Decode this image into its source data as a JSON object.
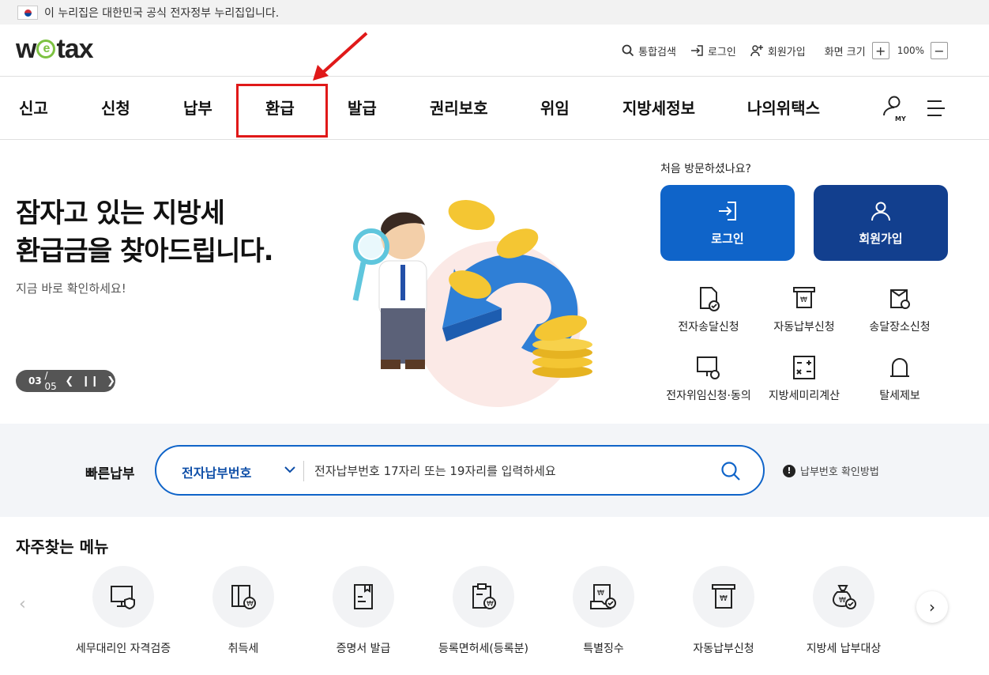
{
  "gov_banner": {
    "text": "이 누리집은 대한민국 공식 전자정부 누리집입니다."
  },
  "header": {
    "logo": {
      "pre": "w",
      "e": "e",
      "post": "tax"
    },
    "search": "통합검색",
    "login": "로그인",
    "signup": "회원가입",
    "zoom_label": "화면 크기",
    "zoom_plus": "+",
    "zoom_value": "100%",
    "zoom_minus": "−"
  },
  "nav": {
    "items": [
      "신고",
      "신청",
      "납부",
      "환급",
      "발급",
      "권리보호",
      "위임",
      "지방세정보",
      "나의위택스"
    ],
    "my_label": "MY"
  },
  "hero": {
    "title_line1": "잠자고 있는 지방세",
    "title_line2": "환급금을 찾아드립니다.",
    "subtitle": "지금 바로 확인하세요!",
    "pager_current": "03",
    "pager_total": "/ 05"
  },
  "side": {
    "first_visit": "처음 방문하셨나요?",
    "login_button": "로그인",
    "join_button": "회원가입",
    "quick_links": [
      "전자송달신청",
      "자동납부신청",
      "송달장소신청",
      "전자위임신청·동의",
      "지방세미리계산",
      "탈세제보"
    ]
  },
  "fastpay": {
    "label": "빠른납부",
    "select_value": "전자납부번호",
    "placeholder": "전자납부번호 17자리 또는 19자리를 입력하세요",
    "help": "납부번호 확인방법"
  },
  "frequent": {
    "title": "자주찾는 메뉴",
    "items": [
      "세무대리인 자격검증",
      "취득세",
      "증명서 발급",
      "등록면허세(등록분)",
      "특별징수",
      "자동납부신청",
      "지방세 납부대상"
    ]
  },
  "colors": {
    "primary": "#0f64c9",
    "navy": "#123f8e",
    "highlight": "#e01919",
    "logo_green": "#7dc242"
  }
}
